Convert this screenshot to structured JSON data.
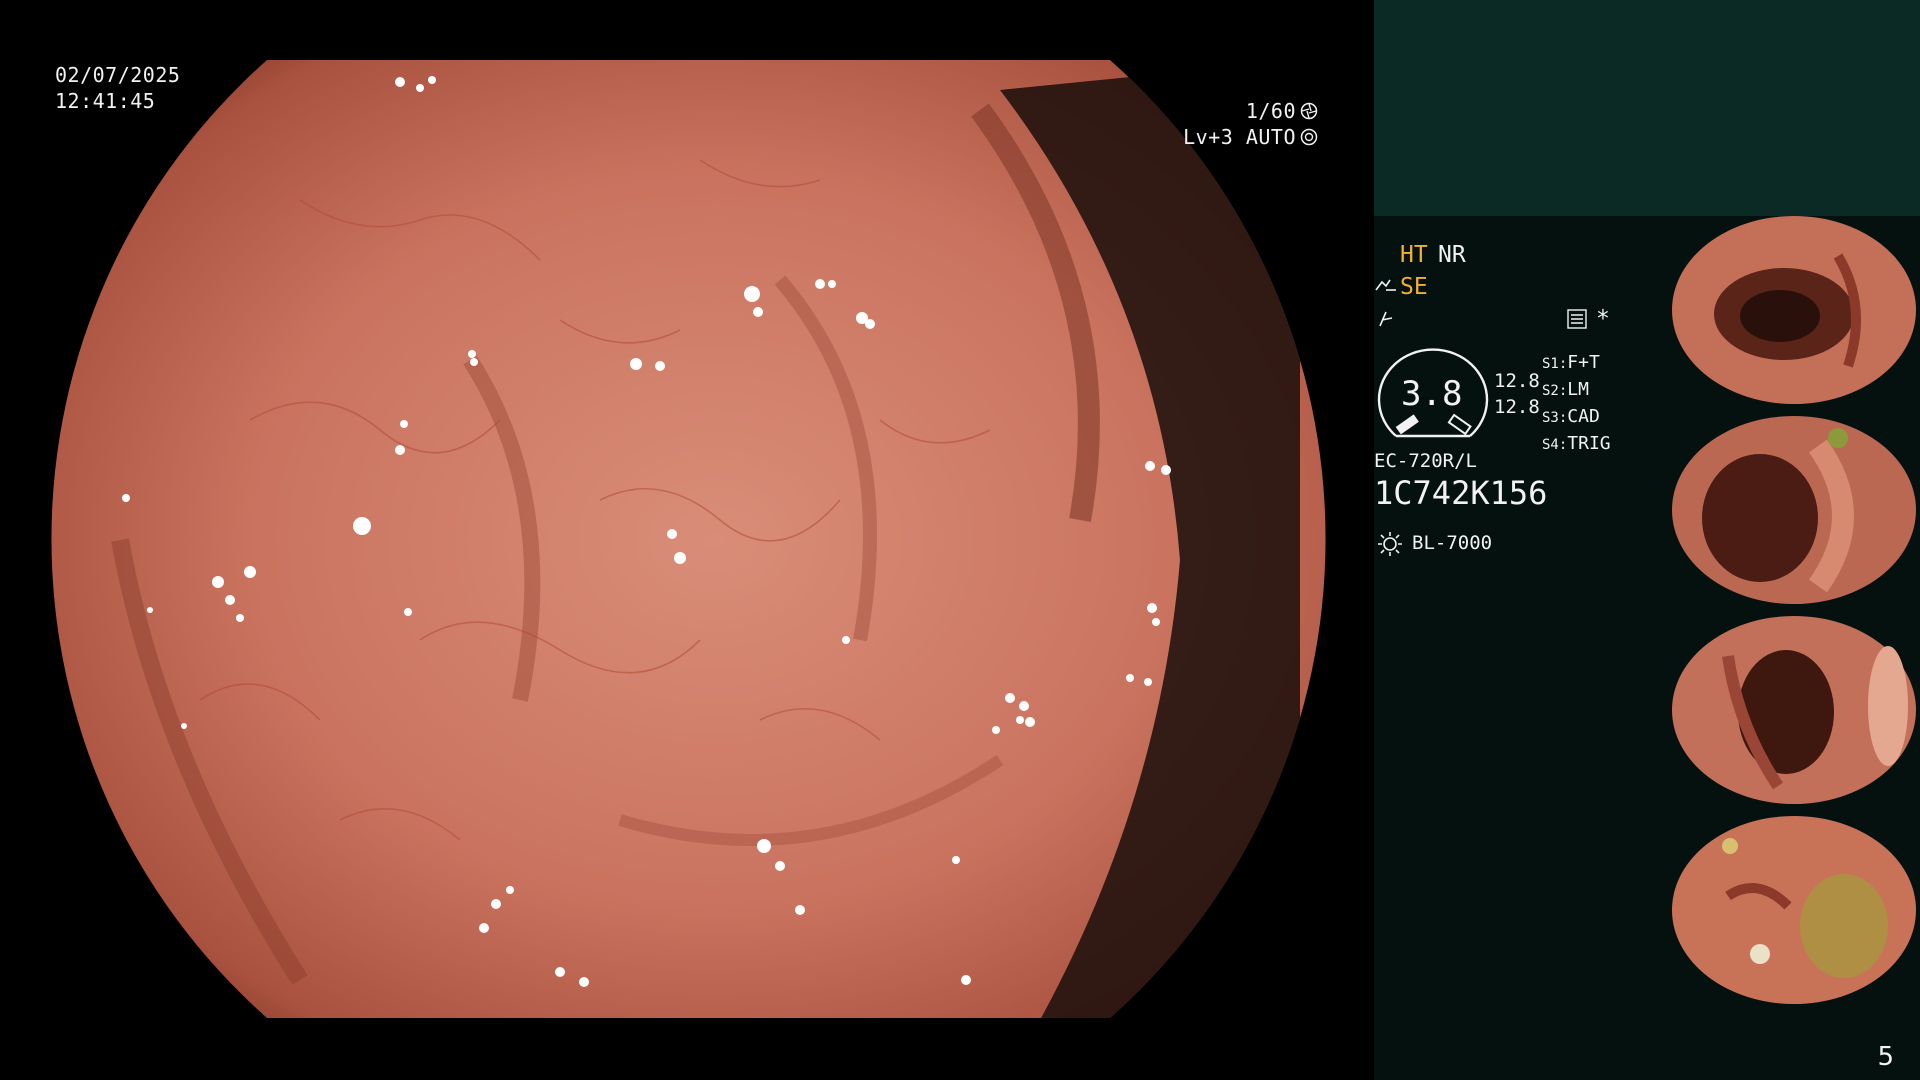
{
  "osd": {
    "date": "02/07/2025",
    "time": "12:41:45",
    "shutter": "1/60",
    "exposure": "Lv+3 AUTO",
    "icon_shutter": "aperture-icon",
    "icon_exposure": "iris-icon"
  },
  "panel": {
    "ht": "HT",
    "nr": "NR",
    "se": "SE",
    "star": "*",
    "zoom_value": "3.8",
    "zoom_a": "12.8",
    "zoom_b": "12.8",
    "s1_key": "S1:",
    "s1_val": "F+T",
    "s2_key": "S2:",
    "s2_val": "LM",
    "s3_key": "S3:",
    "s3_val": "CAD",
    "s4_key": "S4:",
    "s4_val": "TRIG",
    "scope_model": "EC-720R/L",
    "serial": "1C742K156",
    "light_source": "BL-7000",
    "page": "5"
  },
  "colors": {
    "panel_bg": "#05110f",
    "panel_top": "#0b2a26",
    "accent_yellow": "#f0b030",
    "mucosa": "#c9735f"
  },
  "thumbnails": [
    {
      "label": "capture-1"
    },
    {
      "label": "capture-2"
    },
    {
      "label": "capture-3"
    },
    {
      "label": "capture-4"
    }
  ]
}
